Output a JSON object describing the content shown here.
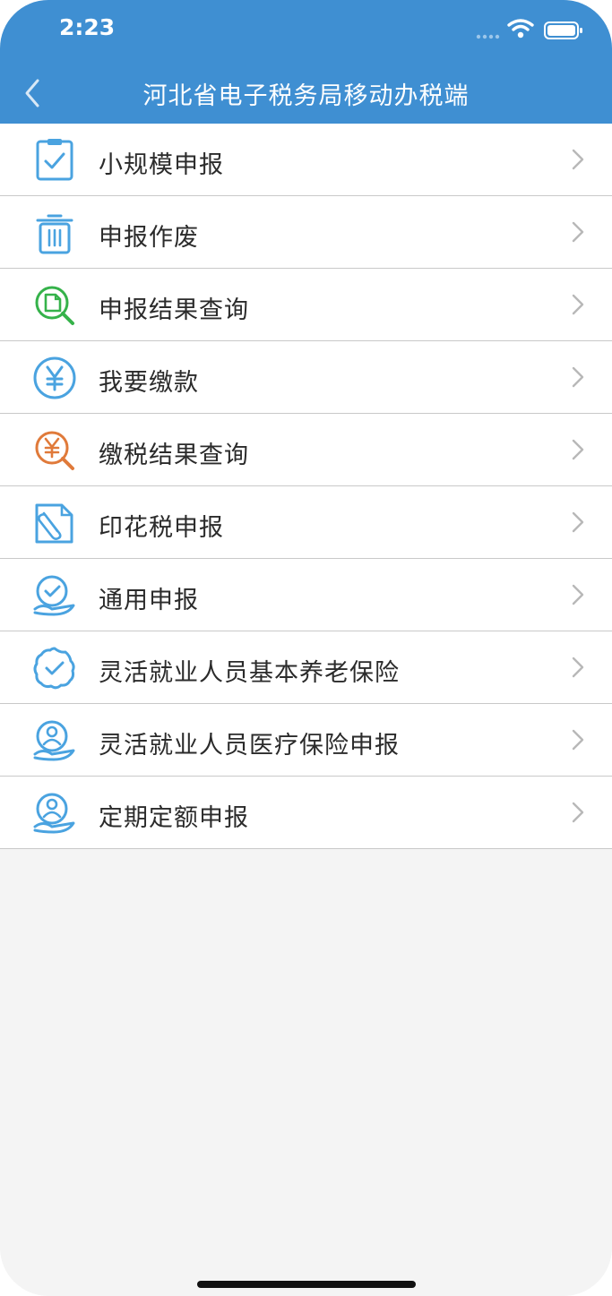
{
  "status_bar": {
    "time": "2:23"
  },
  "header": {
    "title": "河北省电子税务局移动办税端"
  },
  "colors": {
    "header_bg": "#3f8fd2",
    "icon_blue": "#4aa3e0",
    "icon_green": "#35b24a",
    "icon_orange": "#e07a3a"
  },
  "menu": {
    "items": [
      {
        "label": "小规模申报",
        "icon": "clipboard-check-icon"
      },
      {
        "label": "申报作废",
        "icon": "trash-icon"
      },
      {
        "label": "申报结果查询",
        "icon": "document-search-icon"
      },
      {
        "label": "我要缴款",
        "icon": "yen-circle-icon"
      },
      {
        "label": "缴税结果查询",
        "icon": "yen-search-icon"
      },
      {
        "label": "印花税申报",
        "icon": "paperclip-document-icon"
      },
      {
        "label": "通用申报",
        "icon": "hand-check-icon"
      },
      {
        "label": "灵活就业人员基本养老保险",
        "icon": "badge-check-icon"
      },
      {
        "label": "灵活就业人员医疗保险申报",
        "icon": "hand-person-icon"
      },
      {
        "label": "定期定额申报",
        "icon": "hand-person-icon"
      }
    ]
  }
}
